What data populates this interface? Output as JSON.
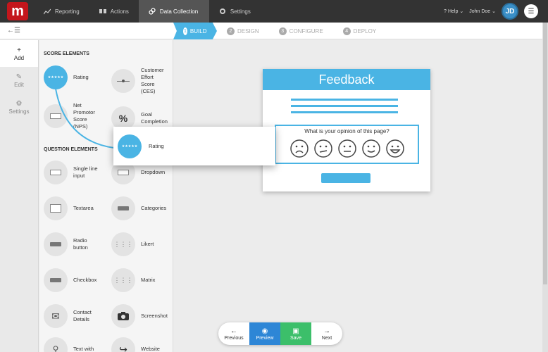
{
  "nav": {
    "logo": "m",
    "items": [
      {
        "label": "Reporting",
        "icon": "chart-icon"
      },
      {
        "label": "Actions",
        "icon": "actions-icon"
      },
      {
        "label": "Data Collection",
        "icon": "link-icon"
      },
      {
        "label": "Settings",
        "icon": "gear-icon"
      }
    ],
    "help": "Help",
    "user": "John Doe",
    "avatar_initials": "JD"
  },
  "steps": [
    {
      "num": "1",
      "label": "BUILD"
    },
    {
      "num": "2",
      "label": "DESIGN"
    },
    {
      "num": "3",
      "label": "CONFIGURE"
    },
    {
      "num": "4",
      "label": "DEPLOY"
    }
  ],
  "rail": [
    {
      "label": "Add",
      "icon": "+"
    },
    {
      "label": "Edit",
      "icon": "✎"
    },
    {
      "label": "Settings",
      "icon": "⚙"
    }
  ],
  "panel": {
    "score_title": "SCORE ELEMENTS",
    "question_title": "QUESTION ELEMENTS",
    "score": {
      "rating": "Rating",
      "ces_1": "Customer",
      "ces_2": "Effort",
      "ces_3": "Score",
      "ces_4": "(CES)",
      "nps_1": "Net",
      "nps_2": "Promotor",
      "nps_3": "Score",
      "nps_4": "(NPS)",
      "goal_1": "Goal",
      "goal_2": "Completion"
    },
    "question": {
      "single_1": "Single line",
      "single_2": "input",
      "dropdown": "Dropdown",
      "textarea": "Textarea",
      "categories": "Categories",
      "radio_1": "Radio",
      "radio_2": "button",
      "likert": "Likert",
      "checkbox": "Checkbox",
      "matrix": "Matrix",
      "contact_1": "Contact",
      "contact_2": "Details",
      "screenshot": "Screenshot",
      "textwith": "Text with",
      "website": "Website"
    }
  },
  "ghost_label": "Rating",
  "card": {
    "title": "Feedback",
    "question": "What is your opinion of this page?"
  },
  "toolbar": {
    "previous": "Previous",
    "preview": "Preview",
    "save": "Save",
    "next": "Next"
  },
  "colors": {
    "accent": "#4ab4e4",
    "brand": "#c4161c",
    "save": "#3cbf6a",
    "preview": "#2d86d6"
  }
}
